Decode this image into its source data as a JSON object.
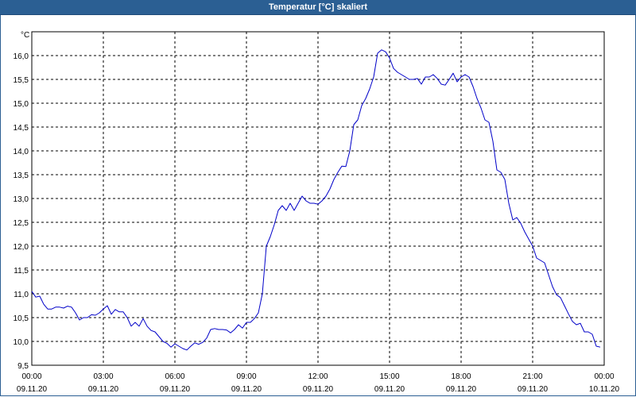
{
  "window": {
    "title": "Temperatur [°C] skaliert"
  },
  "chart_data": {
    "type": "line",
    "title": "Temperatur [°C] skaliert",
    "ylabel": "°C",
    "xlabel": "",
    "ylim": [
      9.5,
      16.5
    ],
    "yticks": [
      9.5,
      10.0,
      10.5,
      11.0,
      11.5,
      12.0,
      12.5,
      13.0,
      13.5,
      14.0,
      14.5,
      15.0,
      15.5,
      16.0
    ],
    "ytick_labels": [
      "9,5",
      "10,0",
      "10,5",
      "11,0",
      "11,5",
      "12,0",
      "12,5",
      "13,0",
      "13,5",
      "14,0",
      "14,5",
      "15,0",
      "15,5",
      "16,0"
    ],
    "xlim_hours": [
      0,
      24
    ],
    "xticks": [
      {
        "time": "00:00",
        "date": "09.11.20"
      },
      {
        "time": "03:00",
        "date": "09.11.20"
      },
      {
        "time": "06:00",
        "date": "09.11.20"
      },
      {
        "time": "09:00",
        "date": "09.11.20"
      },
      {
        "time": "12:00",
        "date": "09.11.20"
      },
      {
        "time": "15:00",
        "date": "09.11.20"
      },
      {
        "time": "18:00",
        "date": "09.11.20"
      },
      {
        "time": "21:00",
        "date": "09.11.20"
      },
      {
        "time": "00:00",
        "date": "10.11.20"
      }
    ],
    "grid": true,
    "series": [
      {
        "color": "#0000c8",
        "points": [
          [
            "00:00",
            11.05
          ],
          [
            "00:10",
            10.93
          ],
          [
            "00:20",
            10.95
          ],
          [
            "00:30",
            10.78
          ],
          [
            "00:40",
            10.68
          ],
          [
            "00:50",
            10.68
          ],
          [
            "01:00",
            10.72
          ],
          [
            "01:10",
            10.72
          ],
          [
            "01:20",
            10.7
          ],
          [
            "01:30",
            10.74
          ],
          [
            "01:40",
            10.72
          ],
          [
            "01:50",
            10.6
          ],
          [
            "02:00",
            10.45
          ],
          [
            "02:10",
            10.5
          ],
          [
            "02:20",
            10.5
          ],
          [
            "02:30",
            10.56
          ],
          [
            "02:40",
            10.55
          ],
          [
            "02:50",
            10.6
          ],
          [
            "03:00",
            10.68
          ],
          [
            "03:10",
            10.75
          ],
          [
            "03:20",
            10.57
          ],
          [
            "03:30",
            10.67
          ],
          [
            "03:40",
            10.62
          ],
          [
            "03:50",
            10.62
          ],
          [
            "04:00",
            10.5
          ],
          [
            "04:10",
            10.32
          ],
          [
            "04:20",
            10.4
          ],
          [
            "04:30",
            10.32
          ],
          [
            "04:40",
            10.48
          ],
          [
            "04:50",
            10.32
          ],
          [
            "05:00",
            10.23
          ],
          [
            "05:10",
            10.2
          ],
          [
            "05:20",
            10.1
          ],
          [
            "05:30",
            10.0
          ],
          [
            "05:40",
            9.96
          ],
          [
            "05:50",
            9.88
          ],
          [
            "06:00",
            9.95
          ],
          [
            "06:10",
            9.9
          ],
          [
            "06:20",
            9.85
          ],
          [
            "06:30",
            9.82
          ],
          [
            "06:40",
            9.9
          ],
          [
            "06:50",
            9.97
          ],
          [
            "07:00",
            9.94
          ],
          [
            "07:10",
            9.98
          ],
          [
            "07:20",
            10.07
          ],
          [
            "07:30",
            10.25
          ],
          [
            "07:40",
            10.27
          ],
          [
            "07:50",
            10.25
          ],
          [
            "08:00",
            10.25
          ],
          [
            "08:10",
            10.24
          ],
          [
            "08:20",
            10.18
          ],
          [
            "08:30",
            10.25
          ],
          [
            "08:40",
            10.35
          ],
          [
            "08:50",
            10.28
          ],
          [
            "09:00",
            10.4
          ],
          [
            "09:10",
            10.4
          ],
          [
            "09:20",
            10.48
          ],
          [
            "09:30",
            10.6
          ],
          [
            "09:40",
            11.0
          ],
          [
            "09:50",
            12.0
          ],
          [
            "10:00",
            12.2
          ],
          [
            "10:10",
            12.45
          ],
          [
            "10:20",
            12.75
          ],
          [
            "10:30",
            12.85
          ],
          [
            "10:40",
            12.75
          ],
          [
            "10:50",
            12.9
          ],
          [
            "11:00",
            12.75
          ],
          [
            "11:10",
            12.9
          ],
          [
            "11:20",
            13.05
          ],
          [
            "11:30",
            12.95
          ],
          [
            "11:40",
            12.9
          ],
          [
            "11:50",
            12.9
          ],
          [
            "12:00",
            12.88
          ],
          [
            "12:10",
            12.95
          ],
          [
            "12:20",
            13.05
          ],
          [
            "12:30",
            13.2
          ],
          [
            "12:40",
            13.4
          ],
          [
            "12:50",
            13.55
          ],
          [
            "13:00",
            13.68
          ],
          [
            "13:10",
            13.67
          ],
          [
            "13:20",
            14.0
          ],
          [
            "13:30",
            14.55
          ],
          [
            "13:40",
            14.65
          ],
          [
            "13:50",
            14.95
          ],
          [
            "14:00",
            15.1
          ],
          [
            "14:10",
            15.3
          ],
          [
            "14:20",
            15.55
          ],
          [
            "14:30",
            16.05
          ],
          [
            "14:40",
            16.12
          ],
          [
            "14:50",
            16.08
          ],
          [
            "15:00",
            15.95
          ],
          [
            "15:10",
            15.73
          ],
          [
            "15:20",
            15.65
          ],
          [
            "15:30",
            15.6
          ],
          [
            "15:40",
            15.55
          ],
          [
            "15:50",
            15.5
          ],
          [
            "16:00",
            15.5
          ],
          [
            "16:10",
            15.52
          ],
          [
            "16:20",
            15.4
          ],
          [
            "16:30",
            15.55
          ],
          [
            "16:40",
            15.55
          ],
          [
            "16:50",
            15.6
          ],
          [
            "17:00",
            15.52
          ],
          [
            "17:10",
            15.4
          ],
          [
            "17:20",
            15.38
          ],
          [
            "17:30",
            15.5
          ],
          [
            "17:40",
            15.63
          ],
          [
            "17:50",
            15.45
          ],
          [
            "18:00",
            15.55
          ],
          [
            "18:10",
            15.6
          ],
          [
            "18:20",
            15.55
          ],
          [
            "18:30",
            15.35
          ],
          [
            "18:40",
            15.1
          ],
          [
            "18:50",
            14.9
          ],
          [
            "19:00",
            14.65
          ],
          [
            "19:10",
            14.6
          ],
          [
            "19:20",
            14.2
          ],
          [
            "19:30",
            13.6
          ],
          [
            "19:40",
            13.55
          ],
          [
            "19:50",
            13.4
          ],
          [
            "20:00",
            12.9
          ],
          [
            "20:10",
            12.55
          ],
          [
            "20:20",
            12.6
          ],
          [
            "20:30",
            12.48
          ],
          [
            "20:40",
            12.3
          ],
          [
            "20:50",
            12.15
          ],
          [
            "21:00",
            12.0
          ],
          [
            "21:10",
            11.75
          ],
          [
            "21:20",
            11.7
          ],
          [
            "21:30",
            11.65
          ],
          [
            "21:40",
            11.4
          ],
          [
            "21:50",
            11.15
          ],
          [
            "22:00",
            10.98
          ],
          [
            "22:10",
            10.92
          ],
          [
            "22:20",
            10.75
          ],
          [
            "22:30",
            10.58
          ],
          [
            "22:40",
            10.42
          ],
          [
            "22:50",
            10.35
          ],
          [
            "23:00",
            10.38
          ],
          [
            "23:10",
            10.2
          ],
          [
            "23:20",
            10.2
          ],
          [
            "23:30",
            10.15
          ],
          [
            "23:40",
            9.9
          ],
          [
            "23:50",
            9.88
          ]
        ]
      }
    ]
  }
}
